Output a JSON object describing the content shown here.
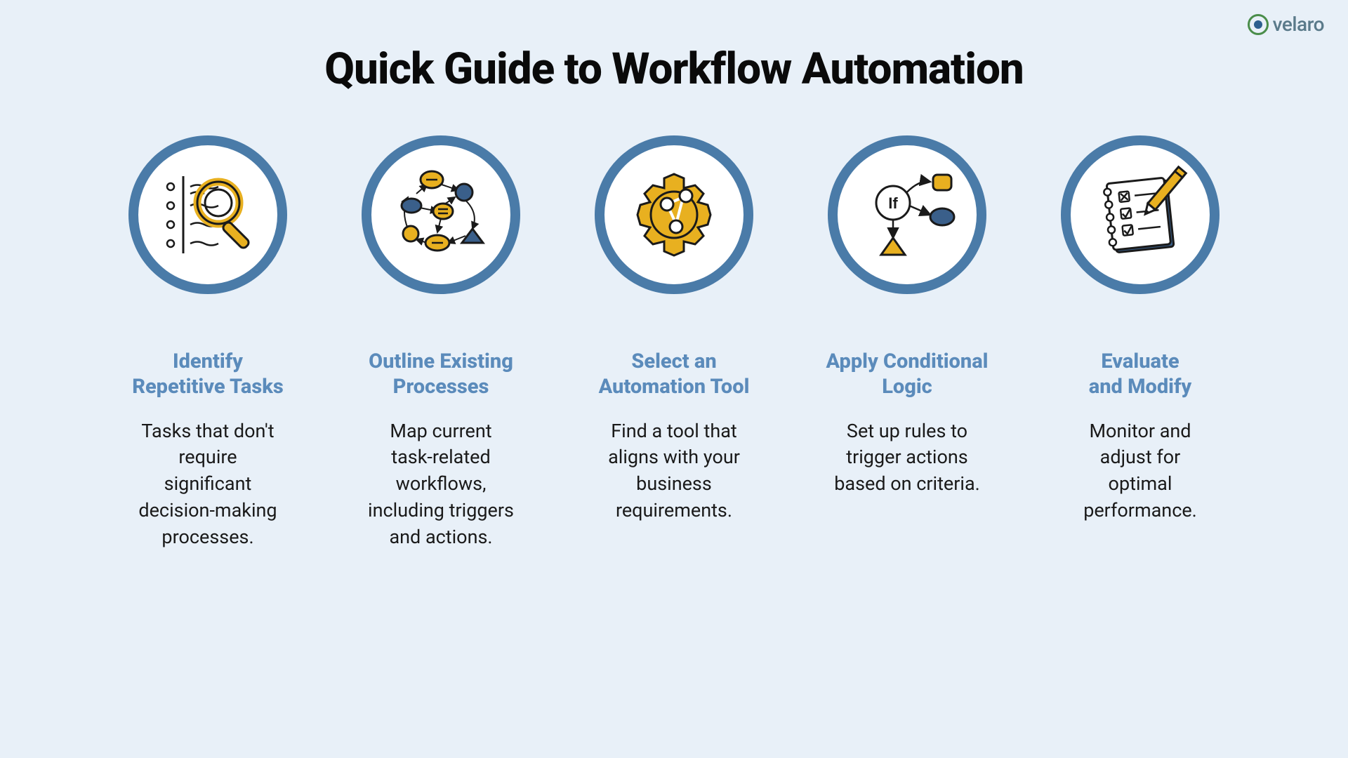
{
  "brand": {
    "name": "velaro"
  },
  "title": "Quick Guide to Workflow Automation",
  "steps": [
    {
      "icon": "magnifier-list-icon",
      "title": "Identify\nRepetitive Tasks",
      "desc": "Tasks that don't\nrequire\nsignificant\ndecision-making\nprocesses."
    },
    {
      "icon": "process-graph-icon",
      "title": "Outline Existing\nProcesses",
      "desc": "Map current\ntask-related\nworkflows,\nincluding triggers\nand actions."
    },
    {
      "icon": "gear-share-icon",
      "title": "Select an\nAutomation Tool",
      "desc": "Find a tool that\naligns with your\nbusiness\nrequirements."
    },
    {
      "icon": "conditional-if-icon",
      "title": "Apply Conditional\nLogic",
      "desc": "Set up rules to\ntrigger actions\nbased on criteria."
    },
    {
      "icon": "checklist-pencil-icon",
      "title": "Evaluate\nand Modify",
      "desc": "Monitor and\nadjust  for\noptimal\nperformance."
    }
  ]
}
